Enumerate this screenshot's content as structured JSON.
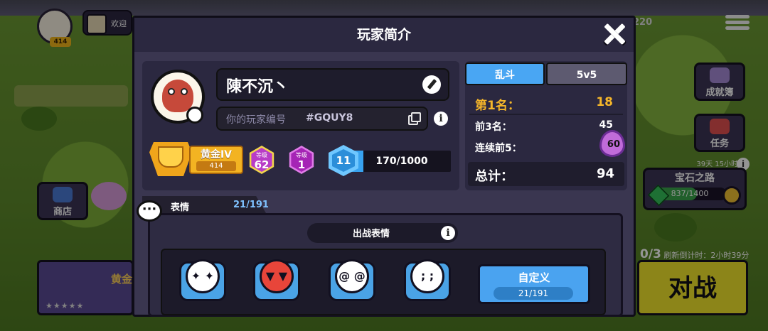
{
  "hud": {
    "level": "414",
    "notice_label": "欢迎",
    "count": "220",
    "side_buttons": {
      "achievements": "成就簿",
      "tasks": "任务",
      "shop": "商店"
    },
    "gem_path": {
      "timer": "39天 15小时",
      "title": "宝石之路",
      "progress": "837/1400",
      "progress_fraction": 0.598
    },
    "battle": {
      "label": "对战",
      "slots": "0/3",
      "refresh": "刷新倒计时：2小时39分"
    },
    "left_rank_label": "黄金",
    "stars": "★★★★★"
  },
  "modal": {
    "title": "玩家简介",
    "player": {
      "name": "陳不沉丶",
      "id_label": "你的玩家编号",
      "id_value": "#GQUY8",
      "rank_name": "黄金IV",
      "rank_trophies": "414",
      "badge1_label": "等级",
      "badge1_value": "62",
      "badge2_label": "等级",
      "badge2_value": "1",
      "level": "11",
      "xp": "170/1000",
      "xp_fraction": 0.17
    },
    "stats": {
      "tabs": [
        "乱斗",
        "5v5"
      ],
      "active_tab": 0,
      "first_label": "第1名：",
      "first_value": "18",
      "top3_label": "前3名：",
      "top3_value": "45",
      "streak_label": "连续前5：",
      "streak_value": "60",
      "total_label": "总计：",
      "total_value": "94"
    },
    "emotes": {
      "title": "表情",
      "count": "21/191",
      "section_title": "出战表情",
      "custom_label": "自定义",
      "custom_count": "21/191"
    }
  },
  "colors": {
    "accent_blue": "#49a6f3",
    "gold": "#f5b62a",
    "panel": "#2b2840",
    "battle_yellow": "#f2e52b"
  }
}
